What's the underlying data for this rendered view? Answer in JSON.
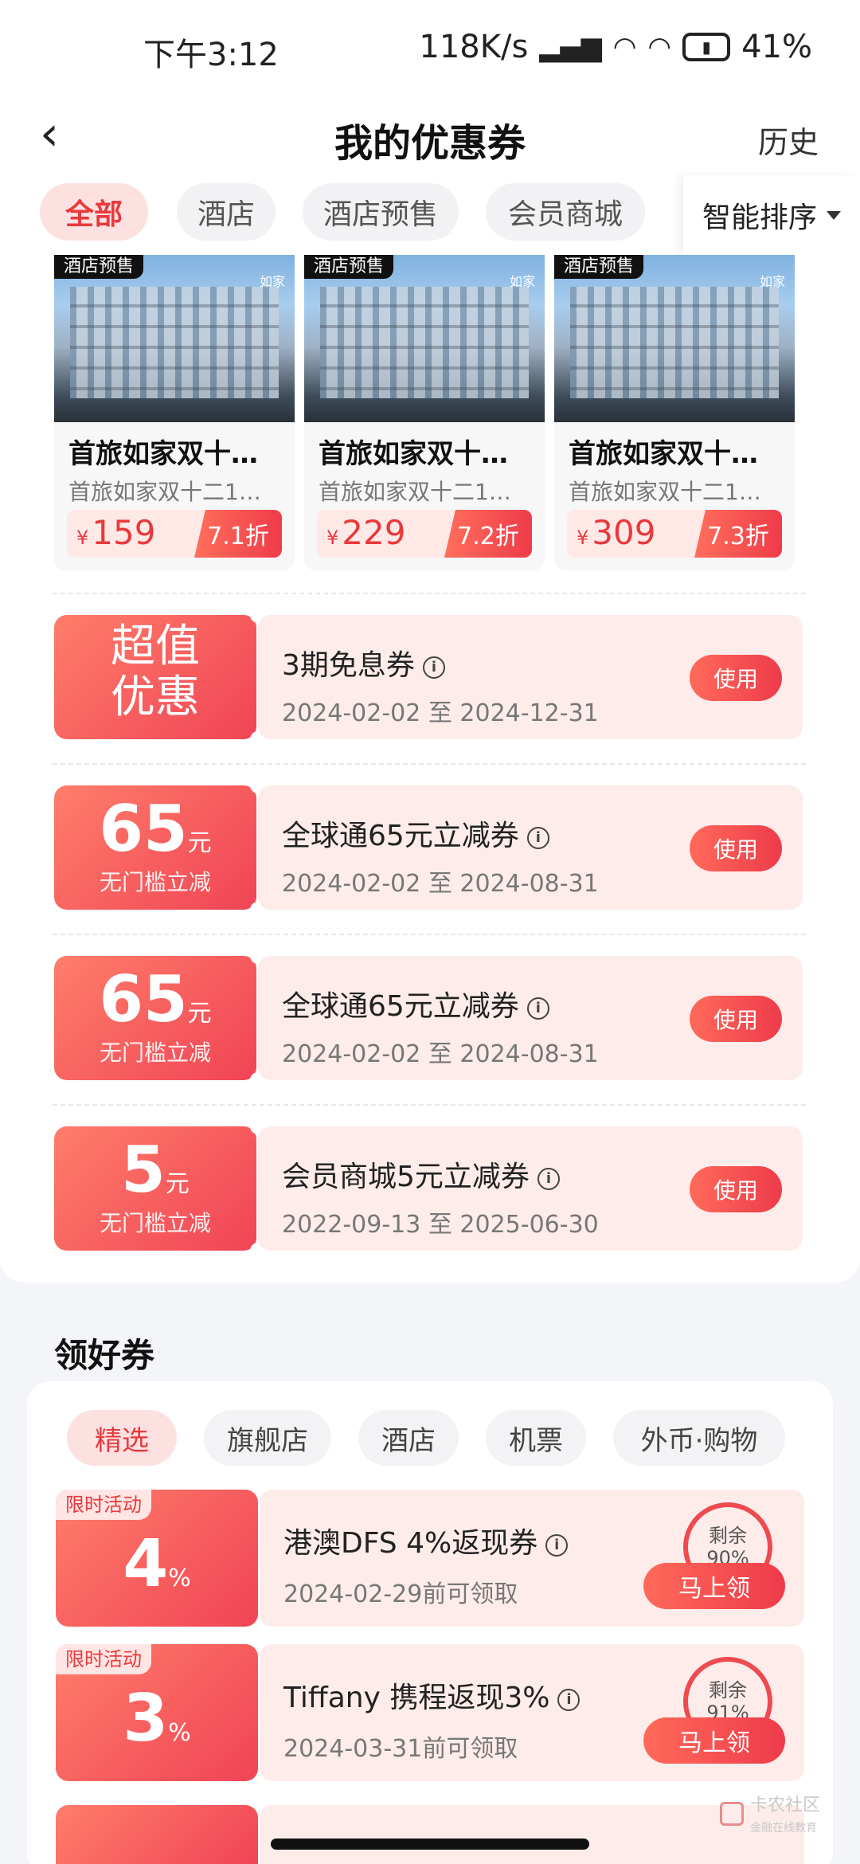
{
  "status": {
    "time": "下午3:12",
    "speed": "118K/s",
    "battery": "41%"
  },
  "header": {
    "title": "我的优惠券",
    "history": "历史"
  },
  "filter_tabs": [
    {
      "label": "全部",
      "active": true
    },
    {
      "label": "酒店",
      "active": false
    },
    {
      "label": "酒店预售",
      "active": false
    },
    {
      "label": "会员商城",
      "active": false
    }
  ],
  "sort_label": "智能排序",
  "products": [
    {
      "tag": "酒店预售",
      "logo": "如家",
      "name": "首旅如家双十…",
      "sub": "首旅如家双十二1…",
      "currency": "¥",
      "price": "159",
      "discount": "7.1折"
    },
    {
      "tag": "酒店预售",
      "logo": "如家",
      "name": "首旅如家双十…",
      "sub": "首旅如家双十二1…",
      "currency": "¥",
      "price": "229",
      "discount": "7.2折"
    },
    {
      "tag": "酒店预售",
      "logo": "如家",
      "name": "首旅如家双十…",
      "sub": "首旅如家双十二1…",
      "currency": "¥",
      "price": "309",
      "discount": "7.3折"
    }
  ],
  "coupons": [
    {
      "left_line1": "超值",
      "left_line2": "优惠",
      "title": "3期免息券",
      "date": "2024-02-02 至 2024-12-31",
      "button": "使用"
    },
    {
      "amount": "65",
      "unit": "元",
      "threshold": "无门槛立减",
      "title": "全球通65元立减券",
      "date": "2024-02-02 至 2024-08-31",
      "button": "使用"
    },
    {
      "amount": "65",
      "unit": "元",
      "threshold": "无门槛立减",
      "title": "全球通65元立减券",
      "date": "2024-02-02 至 2024-08-31",
      "button": "使用"
    },
    {
      "amount": "5",
      "unit": "元",
      "threshold": "无门槛立减",
      "title": "会员商城5元立减券",
      "date": "2022-09-13 至 2025-06-30",
      "button": "使用"
    }
  ],
  "section2": {
    "title": "领好券",
    "tabs": [
      {
        "label": "精选",
        "active": true
      },
      {
        "label": "旗舰店",
        "active": false
      },
      {
        "label": "酒店",
        "active": false
      },
      {
        "label": "机票",
        "active": false
      },
      {
        "label": "外币·购物",
        "active": false
      }
    ],
    "promos": [
      {
        "tag": "限时活动",
        "amount": "4",
        "unit": "%",
        "title": "港澳DFS 4%返现券",
        "date": "2024-02-29前可领取",
        "remain_label": "剩余",
        "remain_pct": "90%",
        "remain_value": 0.9,
        "button": "马上领"
      },
      {
        "tag": "限时活动",
        "amount": "3",
        "unit": "%",
        "title": "Tiffany 携程返现3%",
        "date": "2024-03-31前可领取",
        "remain_label": "剩余",
        "remain_pct": "91%",
        "remain_value": 0.91,
        "button": "马上领"
      }
    ]
  },
  "watermark": {
    "title": "卡农社区",
    "subtitle": "金融在线教育"
  },
  "colors": {
    "accent": "#e8393d",
    "coupon_gradient_start": "#ff7d6a",
    "coupon_gradient_end": "#f04455",
    "coupon_bg": "#fdecea"
  }
}
